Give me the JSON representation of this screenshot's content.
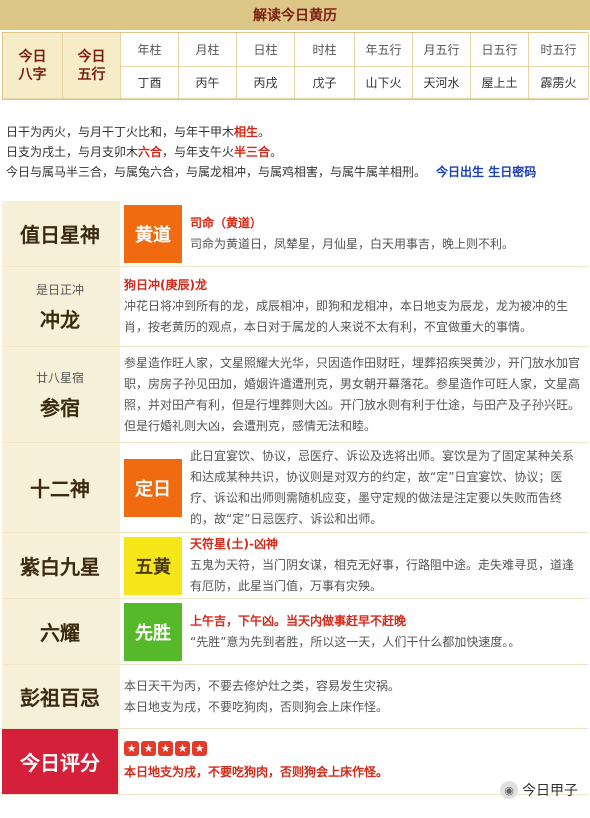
{
  "header": {
    "title": "解读今日黄历"
  },
  "bazi": {
    "left_label": "今日\n八字",
    "pillars": [
      {
        "head": "年柱",
        "val": "丁酉"
      },
      {
        "head": "月柱",
        "val": "丙午"
      },
      {
        "head": "日柱",
        "val": "丙戌"
      },
      {
        "head": "时柱",
        "val": "戊子"
      }
    ],
    "right_label": "今日\n五行",
    "wuxing": [
      {
        "head": "年五行",
        "val": "山下火"
      },
      {
        "head": "月五行",
        "val": "天河水"
      },
      {
        "head": "日五行",
        "val": "屋上土"
      },
      {
        "head": "时五行",
        "val": "霹雳火"
      }
    ]
  },
  "desc": {
    "line1_a": "日干为丙火，与月干丁火比和，与年干甲木",
    "line1_red": "相生",
    "line1_b": "。",
    "line2_a": "日支为戌土，与月支卯木",
    "line2_red1": "六合",
    "line2_b": "，与年支午火",
    "line2_red2": "半三合",
    "line2_c": "。",
    "line3": "今日与属马半三合，与属兔六合，与属龙相冲，与属鸡相害，与属牛属羊相刑。",
    "line3_link": "今日出生 生日密码"
  },
  "rows": [
    {
      "label": "值日星神",
      "badge": "黄道",
      "red": "司命（黄道）",
      "text": "司命为黄道日，凤辇星，月仙星，白天用事吉，晚上则不利。"
    },
    {
      "small": "是日正冲",
      "label": "冲龙",
      "red": "狗日冲(庚辰)龙",
      "text": "冲花日将冲到所有的龙，成辰相冲，即狗和龙相冲，本日地支为辰龙，龙为被冲的生肖，按老黄历的观点，本日对于属龙的人来说不太有利，不宜做重大的事情。"
    },
    {
      "small": "廿八星宿",
      "label": "参宿",
      "text": "参星造作旺人家，文星照耀大光华，只因造作田财旺，埋葬招疾哭黄沙，开门放水加官职，房房子孙见田加，婚姻许遣遭刑克，男女朝开幕落花。参星造作可旺人家，文星高照，并对田产有利，但是行埋葬则大凶。开门放水则有利于仕途，与田产及子孙兴旺。但是行婚礼则大凶，会遭刑克，感情无法和睦。"
    },
    {
      "label": "十二神",
      "badge": "定日",
      "text": "此日宜宴饮、协议，忌医疗、诉讼及选将出师。宴饮是为了固定某种关系和达成某种共识，协议则是对双方的约定，故“定”日宜宴饮、协议；医疗、诉讼和出师则需随机应变，墨守定规的做法是注定要以失败而告终的，故“定”日忌医疗、诉讼和出师。"
    },
    {
      "label": "紫白九星",
      "badge": "五黄",
      "red": "天符星(土)-凶神",
      "text": "五鬼为天符，当门阴女谋，相克无好事，行路阻中途。走失难寻觅，道逢有厄防，此星当门值，万事有灾殃。"
    },
    {
      "label": "六耀",
      "badge": "先胜",
      "red": "上午吉，下午凶。当天内做事赶早不赶晚",
      "text": "“先胜”意为先到者胜，所以这一天，人们干什么都加快速度。。"
    },
    {
      "label": "彭祖百忌",
      "text1": "本日天干为丙，不要去修炉灶之类，容易发生灾祸。",
      "text2": "本日地支为戌，不要吃狗肉，否则狗会上床作怪。"
    },
    {
      "label": "今日评分",
      "stars": 5,
      "red": "本日地支为戌，不要吃狗肉，否则狗会上床作怪。"
    }
  ],
  "brand": {
    "name": "今日甲子",
    "icon": "wechat-icon"
  },
  "colors": {
    "title_bg": "#ddc788",
    "label_bg": "#f6f0d8",
    "red": "#d42a1a",
    "orange": "#f06a0f",
    "yellow": "#f5e61a",
    "green": "#56b92a",
    "score_bg": "#d5203c"
  }
}
